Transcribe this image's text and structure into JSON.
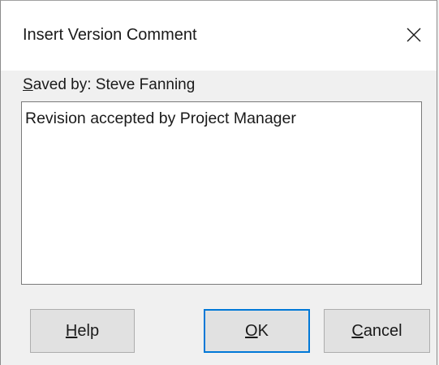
{
  "dialog": {
    "title": "Insert Version Comment",
    "close_icon": "close-icon",
    "saved_by_prefix": "S",
    "saved_by_rest": "aved by: Steve Fanning",
    "comment_value": "Revision accepted by Project Manager"
  },
  "buttons": {
    "help_mnemonic": "H",
    "help_rest": "elp",
    "ok_mnemonic": "O",
    "ok_rest": "K",
    "cancel_mnemonic": "C",
    "cancel_rest": "ancel"
  },
  "colors": {
    "default_button_border": "#0078d7",
    "titlebar_bg": "#ffffff",
    "dialog_bg": "#f0f0f0"
  }
}
